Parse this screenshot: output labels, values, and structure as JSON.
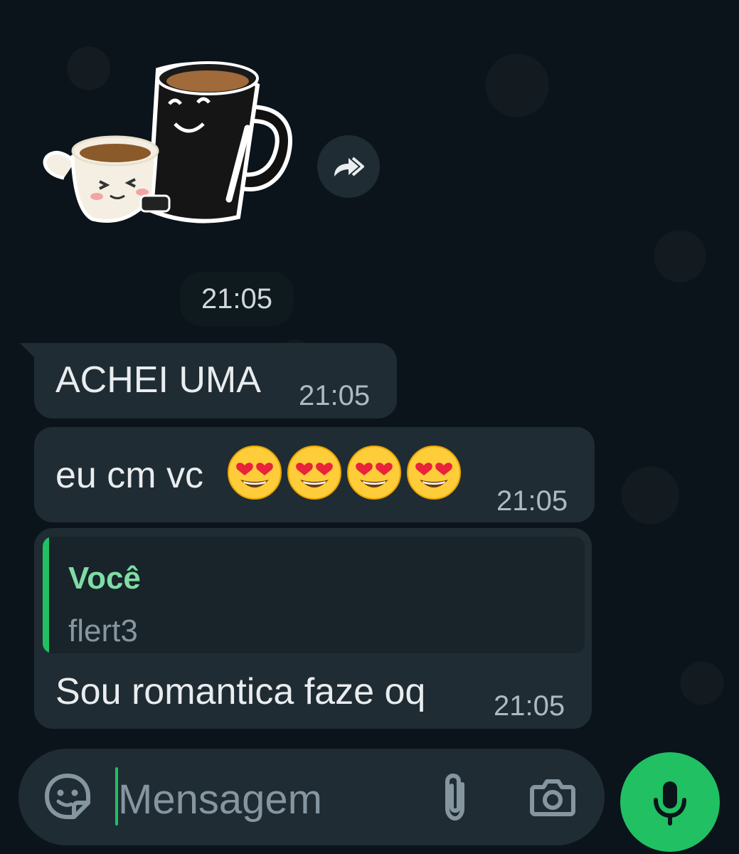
{
  "chat": {
    "sticker_time": "21:05",
    "messages": [
      {
        "text": "ACHEI UMA",
        "time": "21:05"
      },
      {
        "text": "eu cm vc",
        "emojis": [
          "heart-eyes",
          "heart-eyes",
          "heart-eyes",
          "heart-eyes"
        ],
        "time": "21:05"
      },
      {
        "quote_author": "Você",
        "quote_text": "flert3",
        "text": "Sou romantica faze oq",
        "time": "21:05"
      }
    ]
  },
  "input": {
    "placeholder": "Mensagem"
  },
  "colors": {
    "background": "#0b141a",
    "bubble": "#202c33",
    "accent": "#21c063",
    "quote_author": "#7fdca4"
  },
  "icons": {
    "forward": "forward-icon",
    "sticker": "sticker-icon",
    "attach": "paperclip-icon",
    "camera": "camera-icon",
    "mic": "microphone-icon"
  }
}
